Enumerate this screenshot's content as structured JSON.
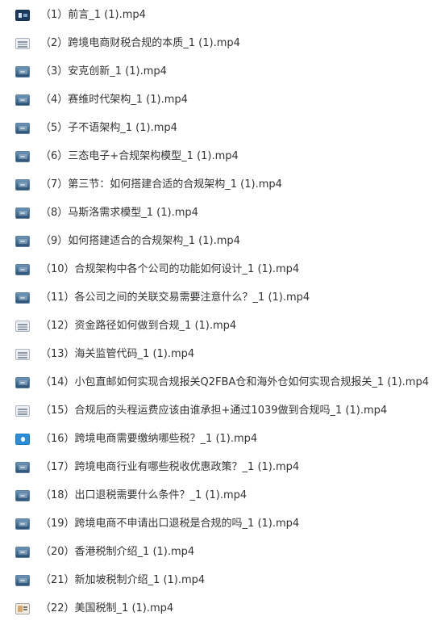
{
  "files": [
    {
      "name": "（1）前言_1 (1).mp4",
      "thumb": "dark"
    },
    {
      "name": "（2）跨境电商财税合规的本质_1 (1).mp4",
      "thumb": "light"
    },
    {
      "name": "（3）安克创新_1 (1).mp4",
      "thumb": "video"
    },
    {
      "name": "（4）赛维时代架构_1 (1).mp4",
      "thumb": "video"
    },
    {
      "name": "（5）子不语架构_1 (1).mp4",
      "thumb": "video"
    },
    {
      "name": "（6）三态电子+合规架构模型_1 (1).mp4",
      "thumb": "video"
    },
    {
      "name": "（7）第三节：如何搭建合适的合规架构_1 (1).mp4",
      "thumb": "video"
    },
    {
      "name": "（8）马斯洛需求模型_1 (1).mp4",
      "thumb": "video"
    },
    {
      "name": "（9）如何搭建适合的合规架构_1 (1).mp4",
      "thumb": "video"
    },
    {
      "name": "（10）合规架构中各个公司的功能如何设计_1 (1).mp4",
      "thumb": "video"
    },
    {
      "name": "（11）各公司之间的关联交易需要注意什么？_1 (1).mp4",
      "thumb": "video"
    },
    {
      "name": "（12）资金路径如何做到合规_1 (1).mp4",
      "thumb": "light"
    },
    {
      "name": "（13）海关监管代码_1 (1).mp4",
      "thumb": "light"
    },
    {
      "name": "（14）小包直邮如何实现合规报关Q2FBA仓和海外仓如何实现合规报关_1 (1).mp4",
      "thumb": "video"
    },
    {
      "name": "（15）合规后的头程运费应该由谁承担+通过1039做到合规吗_1 (1).mp4",
      "thumb": "light"
    },
    {
      "name": "（16）跨境电商需要缴纳哪些税？_1 (1).mp4",
      "thumb": "bright"
    },
    {
      "name": "（17）跨境电商行业有哪些税收优惠政策？_1 (1).mp4",
      "thumb": "video"
    },
    {
      "name": "（18）出口退税需要什么条件？_1 (1).mp4",
      "thumb": "video"
    },
    {
      "name": "（19）跨境电商不申请出口退税是合规的吗_1 (1).mp4",
      "thumb": "video"
    },
    {
      "name": "（20）香港税制介绍_1 (1).mp4",
      "thumb": "video"
    },
    {
      "name": "（21）新加坡税制介绍_1 (1).mp4",
      "thumb": "video"
    },
    {
      "name": "（22）美国税制_1 (1).mp4",
      "thumb": "warm"
    }
  ]
}
